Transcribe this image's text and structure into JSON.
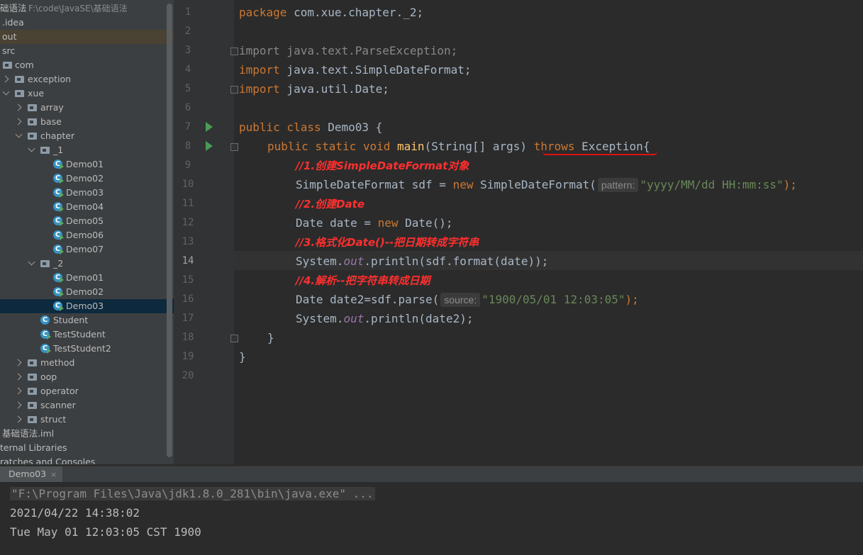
{
  "project_tree": {
    "root_label": "础语法",
    "root_path": "F:\\code\\JavaSE\\基础语法",
    "items": [
      {
        "label": ".idea",
        "type": "folder"
      },
      {
        "label": "out",
        "type": "folder",
        "selected": true
      },
      {
        "label": "src",
        "type": "folder"
      },
      {
        "label": "com",
        "type": "package"
      },
      {
        "label": "exception",
        "type": "package"
      },
      {
        "label": "xue",
        "type": "package"
      },
      {
        "label": "array",
        "type": "package"
      },
      {
        "label": "base",
        "type": "package"
      },
      {
        "label": "chapter",
        "type": "package"
      },
      {
        "label": "_1",
        "type": "package"
      },
      {
        "label": "Demo01",
        "type": "class"
      },
      {
        "label": "Demo02",
        "type": "class"
      },
      {
        "label": "Demo03",
        "type": "class"
      },
      {
        "label": "Demo04",
        "type": "class"
      },
      {
        "label": "Demo05",
        "type": "class"
      },
      {
        "label": "Demo06",
        "type": "class"
      },
      {
        "label": "Demo07",
        "type": "class"
      },
      {
        "label": "_2",
        "type": "package"
      },
      {
        "label": "Demo01",
        "type": "class"
      },
      {
        "label": "Demo02",
        "type": "class"
      },
      {
        "label": "Demo03",
        "type": "class",
        "selected": true
      },
      {
        "label": "Student",
        "type": "class"
      },
      {
        "label": "TestStudent",
        "type": "class"
      },
      {
        "label": "TestStudent2",
        "type": "class"
      },
      {
        "label": "method",
        "type": "package"
      },
      {
        "label": "oop",
        "type": "package"
      },
      {
        "label": "operator",
        "type": "package"
      },
      {
        "label": "scanner",
        "type": "package"
      },
      {
        "label": "struct",
        "type": "package"
      },
      {
        "label": "基础语法.iml",
        "type": "file"
      },
      {
        "label": "ternal Libraries",
        "type": "library"
      },
      {
        "label": "ratches and Consoles",
        "type": "library"
      }
    ]
  },
  "editor": {
    "current_line": "14",
    "line_numbers": [
      "1",
      "2",
      "3",
      "4",
      "5",
      "6",
      "7",
      "8",
      "9",
      "10",
      "11",
      "12",
      "13",
      "14",
      "15",
      "16",
      "17",
      "18",
      "19",
      "20"
    ],
    "code": {
      "l1_kw": "package",
      "l1_rest": " com.xue.chapter._2;",
      "l3_text": "import java.text.ParseException;",
      "l4_kw": "import",
      "l4_rest": " java.text.SimpleDateFormat;",
      "l5_kw": "import",
      "l5_rest": " java.util.Date;",
      "l7_kw": "public class",
      "l7_rest": " Demo03 {",
      "l8_kw": "public static void",
      "l8_fn": "main",
      "l8_mid": "(String[] args) ",
      "l8_throws": "throws",
      "l8_rest": " Exception{",
      "l9_comment": "//1.创建SimpleDateFormat对象",
      "l10_pre": "SimpleDateFormat sdf = ",
      "l10_new": "new",
      "l10_mid": " SimpleDateFormat(",
      "l10_hint": "pattern:",
      "l10_str": "\"yyyy/MM/dd HH:mm:ss\"",
      "l10_end": ");",
      "l11_comment": "//2.创建Date",
      "l12_pre": "Date date = ",
      "l12_new": "new",
      "l12_rest": " Date();",
      "l13_comment": "//3.格式化Date()--把日期转成字符串",
      "l14_pre": "System.",
      "l14_out": "out",
      "l14_rest": ".println(sdf.format(date));",
      "l15_comment": "//4.解析--把字符串转成日期",
      "l16_pre": "Date date2=sdf.parse(",
      "l16_hint": "source:",
      "l16_str": "\"1900/05/01 12:03:05\"",
      "l16_end": ");",
      "l17_pre": "System.",
      "l17_out": "out",
      "l17_rest": ".println(date2);",
      "l18": "}",
      "l19": "}"
    }
  },
  "run": {
    "tab_label": "Demo03",
    "tab_close": "×",
    "console_lines": [
      "\"F:\\Program Files\\Java\\jdk1.8.0_281\\bin\\java.exe\" ...",
      "2021/04/22 14:38:02",
      "Tue May 01 12:03:05 CST 1900"
    ]
  },
  "colors": {
    "keyword": "#cc7832",
    "string": "#6a8759",
    "comment": "#ff2f2f",
    "static_field": "#9876aa",
    "method": "#ffc66d"
  }
}
